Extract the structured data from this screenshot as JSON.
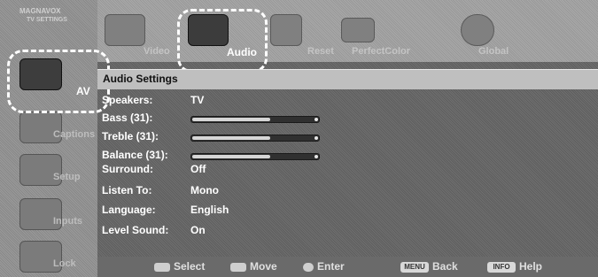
{
  "brand": {
    "line1": "MAGNAVOX",
    "line2": "TV SETTINGS"
  },
  "sidebar": {
    "items": [
      {
        "label": "AV"
      },
      {
        "label": "Captions"
      },
      {
        "label": "Setup"
      },
      {
        "label": "Inputs"
      },
      {
        "label": "Lock"
      }
    ]
  },
  "top_tabs": [
    {
      "label": "Video"
    },
    {
      "label": "Audio"
    },
    {
      "label": "Reset"
    },
    {
      "label": "PerfectColor"
    },
    {
      "label": "Global"
    }
  ],
  "section": {
    "title": "Audio Settings"
  },
  "settings": [
    {
      "label": "Speakers:",
      "value": "TV"
    },
    {
      "label": "Bass (31):",
      "value": "",
      "slider": 0.62
    },
    {
      "label": "Treble (31):",
      "value": "",
      "slider": 0.62
    },
    {
      "label": "Balance (31):",
      "value": "",
      "slider": 0.62
    },
    {
      "label": "Surround:",
      "value": "Off"
    },
    {
      "label": "Listen To:",
      "value": "Mono"
    },
    {
      "label": "Language:",
      "value": "English"
    },
    {
      "label": "Level Sound:",
      "value": "On"
    }
  ],
  "footer": {
    "select": "Select",
    "move": "Move",
    "enter": "Enter",
    "menu_key": "MENU",
    "back": "Back",
    "info_key": "INFO",
    "help": "Help"
  },
  "colors": {
    "highlight_ring": "#ffffff",
    "title_bar": "#bfbfbf"
  }
}
